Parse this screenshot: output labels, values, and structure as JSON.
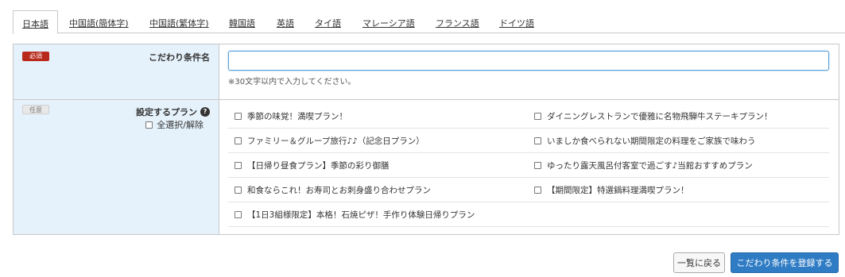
{
  "tabs": [
    {
      "label": "日本語",
      "active": true
    },
    {
      "label": "中国語(簡体字)",
      "active": false
    },
    {
      "label": "中国語(繁体字)",
      "active": false
    },
    {
      "label": "韓国語",
      "active": false
    },
    {
      "label": "英語",
      "active": false
    },
    {
      "label": "タイ語",
      "active": false
    },
    {
      "label": "マレーシア語",
      "active": false
    },
    {
      "label": "フランス語",
      "active": false
    },
    {
      "label": "ドイツ語",
      "active": false
    }
  ],
  "name_field": {
    "badge": "必須",
    "label": "こだわり条件名",
    "value": "",
    "hint": "※30文字以内で入力してください。"
  },
  "plan_field": {
    "badge": "任意",
    "label": "設定するプラン",
    "help_icon": "?",
    "select_all_label": "全選択/解除",
    "plans": [
      {
        "label": "季節の味覚！満喫プラン！",
        "checked": false
      },
      {
        "label": "ダイニングレストランで優雅に名物飛騨牛ステーキプラン！",
        "checked": false
      },
      {
        "label": "ファミリー＆グループ旅行♪♪（記念日プラン）",
        "checked": false
      },
      {
        "label": "いましか食べられない期間限定の料理をご家族で味わう",
        "checked": false
      },
      {
        "label": "【日帰り昼食プラン】季節の彩り御膳",
        "checked": false
      },
      {
        "label": "ゆったり露天風呂付客室で過ごす♪当館おすすめプラン",
        "checked": false
      },
      {
        "label": "和食ならこれ！お寿司とお刺身盛り合わせプラン",
        "checked": false
      },
      {
        "label": "【期間限定】特選鍋料理満喫プラン！",
        "checked": false
      },
      {
        "label": "【1日3組様限定】本格！石焼ピザ！手作り体験日帰りプラン",
        "checked": false
      }
    ]
  },
  "buttons": {
    "back": "一覧に戻る",
    "register": "こだわり条件を登録する"
  },
  "colors": {
    "label_bg": "#e6f2fb",
    "required_badge": "#b8291b",
    "primary_button": "#2f7cc4",
    "input_focus_border": "#5aa0d8"
  }
}
